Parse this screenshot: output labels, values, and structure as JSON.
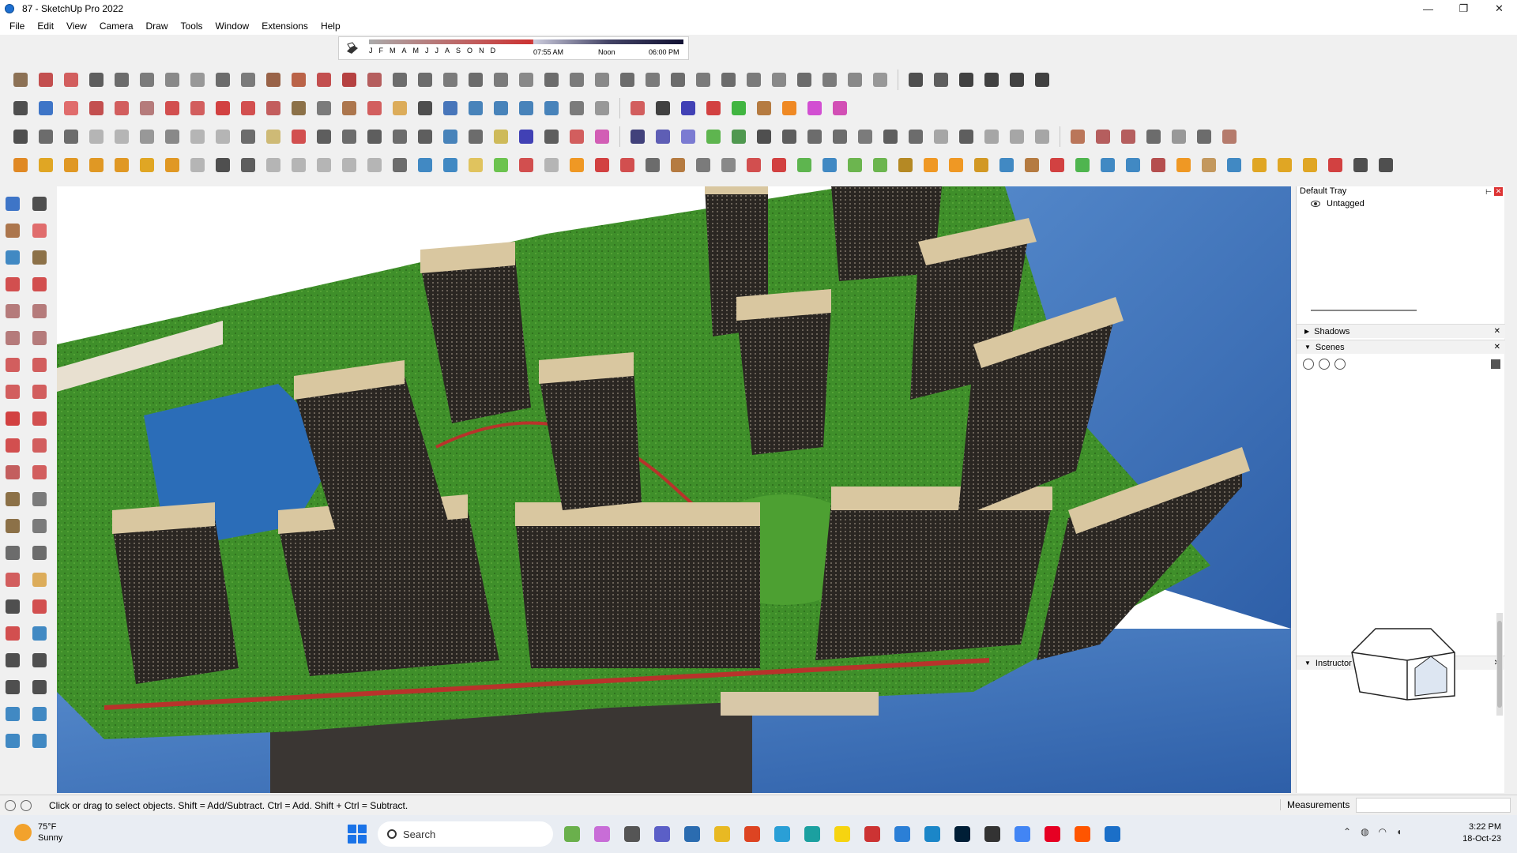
{
  "window": {
    "title": "87 - SketchUp Pro 2022",
    "controls": [
      "—",
      "❐",
      "✕"
    ]
  },
  "menu": [
    "File",
    "Edit",
    "View",
    "Camera",
    "Draw",
    "Tools",
    "Window",
    "Extensions",
    "Help"
  ],
  "shadow_settings": {
    "months": [
      "J",
      "F",
      "M",
      "A",
      "M",
      "J",
      "J",
      "A",
      "S",
      "O",
      "N",
      "D"
    ],
    "time_start": "07:55 AM",
    "time_mid": "Noon",
    "time_end": "06:00 PM"
  },
  "tray": {
    "title": "Default Tray",
    "tag": "Untagged",
    "panels": {
      "shadows": "Shadows",
      "scenes": "Scenes",
      "instructor": "Instructor"
    }
  },
  "status": {
    "text": "Click or drag to select objects. Shift = Add/Subtract. Ctrl = Add. Shift + Ctrl = Subtract.",
    "measurements_label": "Measurements",
    "measurements_value": ""
  },
  "taskbar": {
    "weather_temp": "75°F",
    "weather_desc": "Sunny",
    "search_placeholder": "Search",
    "time": "3:22 PM",
    "date": "18-Oct-23"
  },
  "colors": {
    "accent": "#1e6fd0",
    "sky": "#3b6fb8",
    "grass": "#3f8f2a",
    "building": "#2a2622",
    "building_top": "#d9c7a0",
    "path_red": "#b8332b"
  }
}
